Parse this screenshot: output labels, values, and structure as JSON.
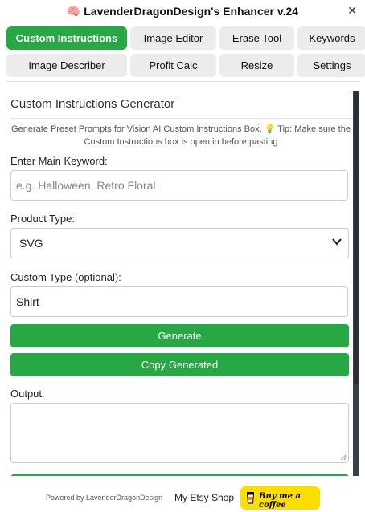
{
  "header": {
    "title": "🧠 LavenderDragonDesign's Enhancer v.24",
    "close_glyph": "✕"
  },
  "tabs": [
    {
      "label": "Custom Instructions",
      "active": true
    },
    {
      "label": "Image Editor",
      "active": false
    },
    {
      "label": "Erase Tool",
      "active": false
    },
    {
      "label": "Keywords",
      "active": false
    },
    {
      "label": "Image Describer",
      "active": false
    },
    {
      "label": "Profit Calc",
      "active": false
    },
    {
      "label": "Resize",
      "active": false
    },
    {
      "label": "Settings",
      "active": false
    }
  ],
  "panel": {
    "title": "Custom Instructions Generator",
    "tip": "Generate Preset Prompts for Vision AI Custom Instructions Box. 💡 Tip: Make sure the Custom Instructions box is open in before pasting",
    "keyword_label": "Enter Main Keyword:",
    "keyword_placeholder": "e.g. Halloween, Retro Floral",
    "keyword_value": "",
    "product_type_label": "Product Type:",
    "product_type_value": "SVG",
    "custom_type_label": "Custom Type (optional):",
    "custom_type_value": "Shirt",
    "generate_label": "Generate",
    "copy_label": "Copy Generated",
    "output_label": "Output:",
    "output_value": ""
  },
  "footer": {
    "powered": "Powered by LavenderDragonDesign",
    "etsy": "My Etsy Shop",
    "coffee": "Buy me a coffee"
  },
  "colors": {
    "accent": "#28a745",
    "coffee": "#ffdd00"
  }
}
